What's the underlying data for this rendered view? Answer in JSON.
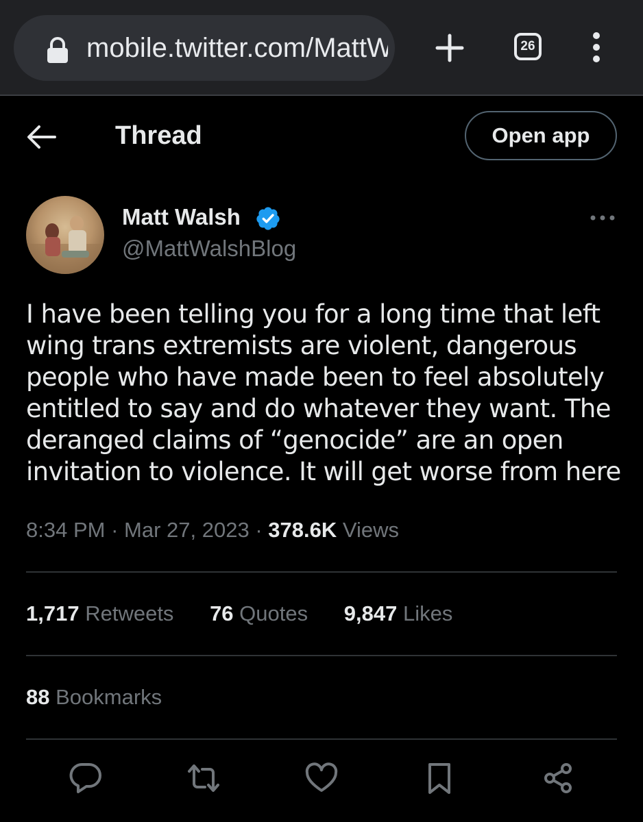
{
  "browser": {
    "url": "mobile.twitter.com/MattW",
    "tab_count": "26",
    "icons": {
      "lock": "lock-icon",
      "new_tab": "plus-icon",
      "menu": "vertical-dots-icon"
    }
  },
  "header": {
    "title": "Thread",
    "open_app_label": "Open app",
    "back_icon": "arrow-left-icon"
  },
  "tweet": {
    "author_name": "Matt Walsh",
    "author_handle": "@MattWalshBlog",
    "verified": true,
    "text": "I have been telling you for a long time that left wing trans extremists are violent, dangerous people who have made been to feel absolutely entitled to say and do whatever they want. The deranged claims of “genocide” are an open invitation to violence. It will get worse from here",
    "time": "8:34 PM",
    "separator": "·",
    "date": "Mar 27, 2023",
    "views_count": "378.6K",
    "views_label": "Views",
    "stats": {
      "retweets_count": "1,717",
      "retweets_label": "Retweets",
      "quotes_count": "76",
      "quotes_label": "Quotes",
      "likes_count": "9,847",
      "likes_label": "Likes",
      "bookmarks_count": "88",
      "bookmarks_label": "Bookmarks"
    },
    "actions": [
      "reply-icon",
      "retweet-icon",
      "like-icon",
      "bookmark-icon",
      "share-icon"
    ]
  },
  "colors": {
    "background": "#000000",
    "primary_text": "#e7e9ea",
    "secondary_text": "#71767b",
    "divider": "#2f3336",
    "verified_blue": "#1d9bf0",
    "browser_bar": "#202124"
  }
}
